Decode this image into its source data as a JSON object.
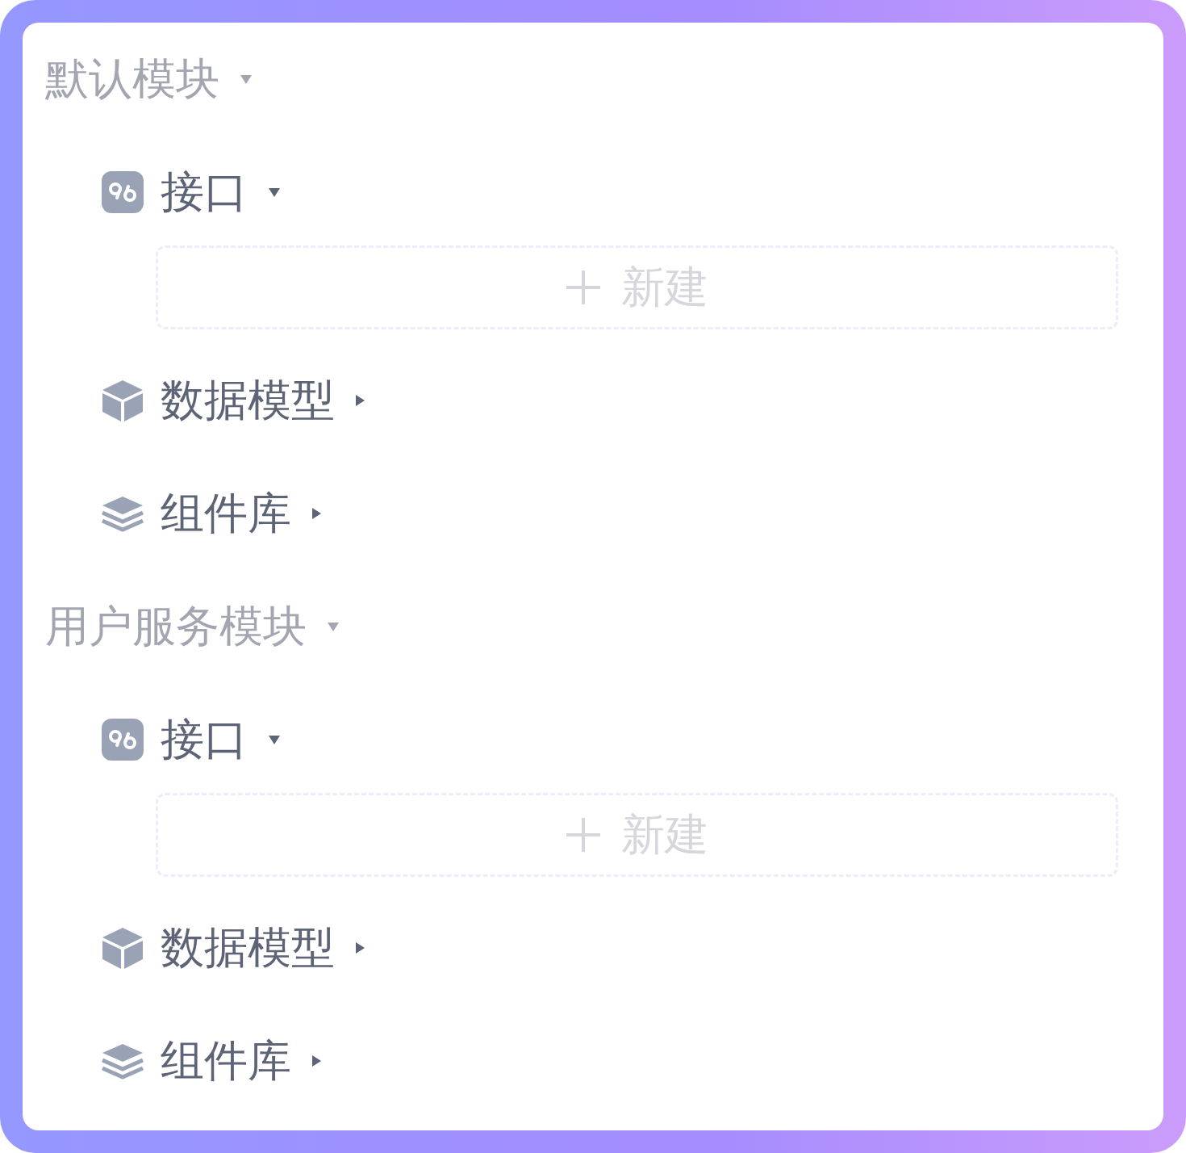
{
  "modules": [
    {
      "name": "默认模块",
      "expanded": true,
      "items": [
        {
          "kind": "api",
          "label": "接口",
          "expanded": true,
          "new_button": "新建"
        },
        {
          "kind": "model",
          "label": "数据模型",
          "expanded": false
        },
        {
          "kind": "library",
          "label": "组件库",
          "expanded": false
        }
      ]
    },
    {
      "name": "用户服务模块",
      "expanded": true,
      "items": [
        {
          "kind": "api",
          "label": "接口",
          "expanded": true,
          "new_button": "新建"
        },
        {
          "kind": "model",
          "label": "数据模型",
          "expanded": false
        },
        {
          "kind": "library",
          "label": "组件库",
          "expanded": false
        }
      ]
    }
  ]
}
